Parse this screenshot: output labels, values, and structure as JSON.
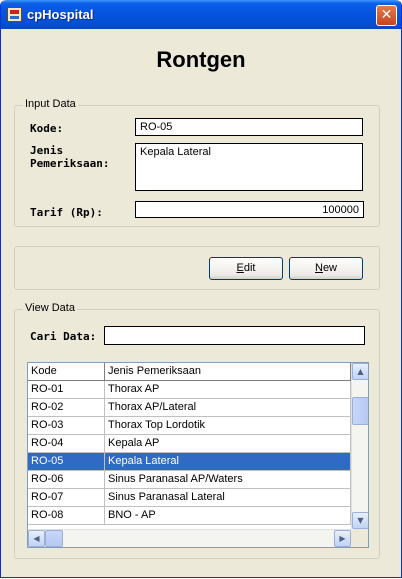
{
  "window": {
    "title": "cpHospital",
    "close_glyph": "✕"
  },
  "heading": "Rontgen",
  "input_group": {
    "legend": "Input Data",
    "kode_label": "Kode:",
    "kode_value": "RO-05",
    "jenis_label_line1": "Jenis",
    "jenis_label_line2": "Pemeriksaan:",
    "jenis_value": "Kepala Lateral",
    "tarif_label": "Tarif (Rp):",
    "tarif_value": "100000"
  },
  "buttons": {
    "edit_mnemonic": "E",
    "edit_rest": "dit",
    "new_mnemonic": "N",
    "new_rest": "ew"
  },
  "view_group": {
    "legend": "View Data",
    "cari_label": "Cari Data:",
    "cari_value": ""
  },
  "table": {
    "columns": [
      "Kode",
      "Jenis Pemeriksaan"
    ],
    "rows": [
      [
        "RO-01",
        "Thorax AP"
      ],
      [
        "RO-02",
        "Thorax AP/Lateral"
      ],
      [
        "RO-03",
        "Thorax Top Lordotik"
      ],
      [
        "RO-04",
        "Kepala AP"
      ],
      [
        "RO-05",
        "Kepala Lateral"
      ],
      [
        "RO-06",
        "Sinus Paranasal AP/Waters"
      ],
      [
        "RO-07",
        "Sinus Paranasal Lateral"
      ],
      [
        "RO-08",
        "BNO - AP"
      ]
    ],
    "selected_index": 4
  },
  "icons": {
    "app": "hospital-app-icon",
    "close": "close-icon",
    "scroll_up": "scroll-up-arrow-icon",
    "scroll_down": "scroll-down-arrow-icon",
    "scroll_left": "scroll-left-arrow-icon",
    "scroll_right": "scroll-right-arrow-icon"
  },
  "colors": {
    "titlebar": "#0553e0",
    "selection": "#316ac5",
    "panel": "#ece9d8"
  }
}
